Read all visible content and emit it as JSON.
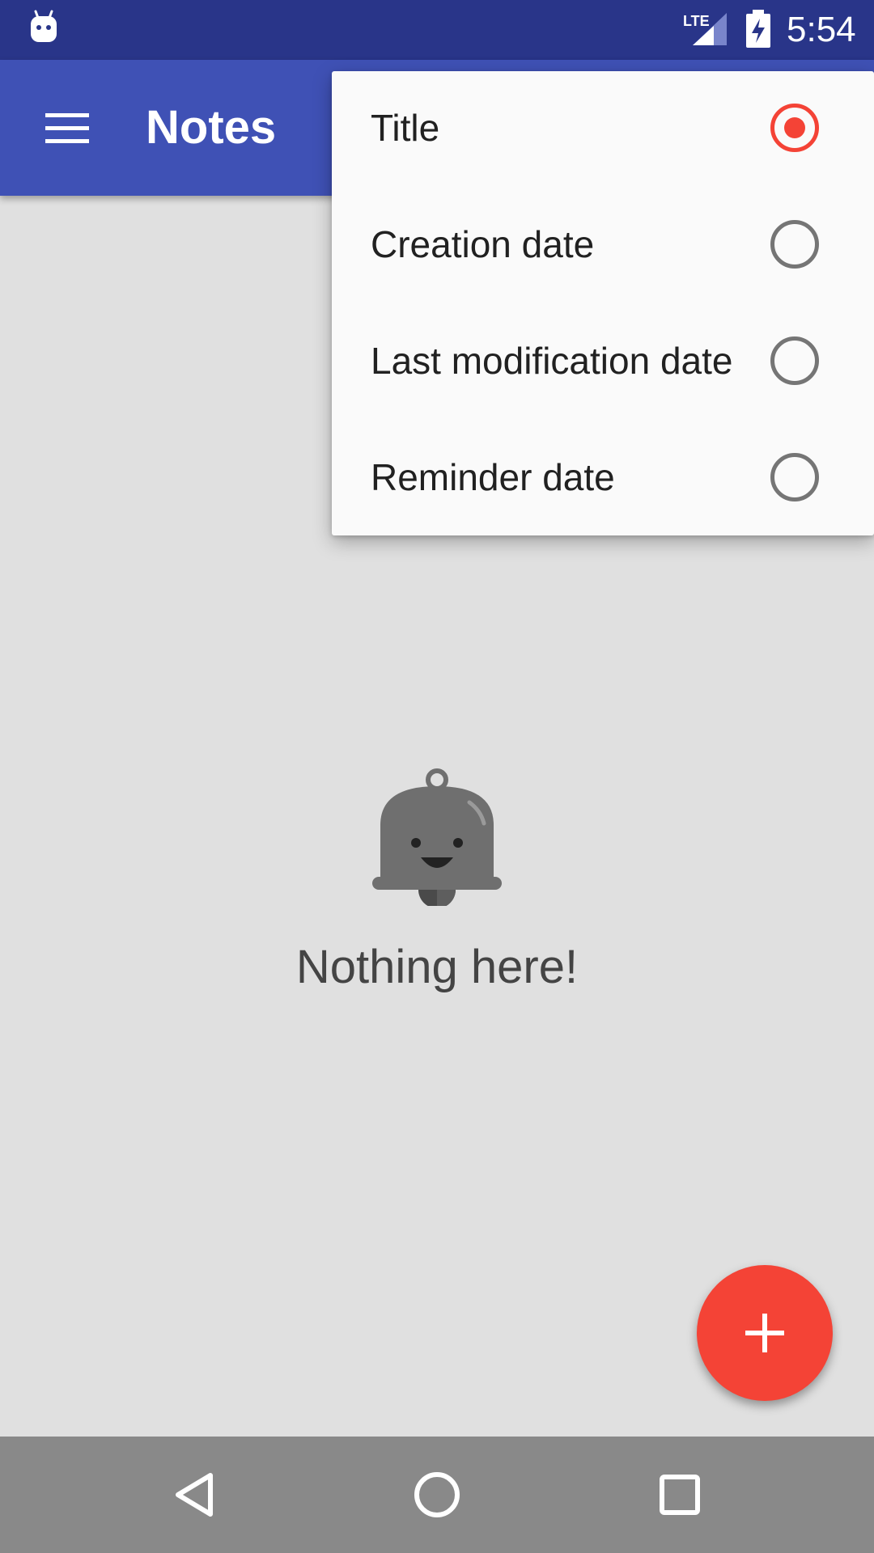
{
  "status_bar": {
    "time": "5:54",
    "network": "LTE",
    "icons": [
      "android-notification-icon",
      "lte-signal-icon",
      "battery-charging-icon"
    ]
  },
  "toolbar": {
    "title": "Notes",
    "menu_icon": "hamburger-menu-icon",
    "color": "#3f51b5"
  },
  "sort_menu": {
    "items": [
      {
        "label": "Title",
        "selected": true
      },
      {
        "label": "Creation date",
        "selected": false
      },
      {
        "label": "Last modification date",
        "selected": false
      },
      {
        "label": "Reminder date",
        "selected": false
      }
    ],
    "accent_color": "#f44336"
  },
  "empty_state": {
    "icon": "bell-face-icon",
    "message": "Nothing here!"
  },
  "fab": {
    "icon": "plus-icon",
    "color": "#f44336"
  },
  "nav_bar": {
    "buttons": [
      "back-icon",
      "home-icon",
      "recents-icon"
    ]
  }
}
